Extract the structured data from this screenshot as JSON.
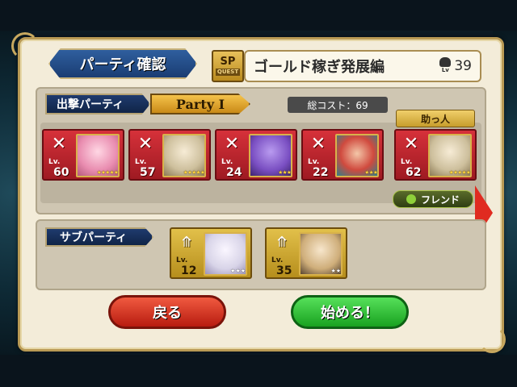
{
  "header": {
    "title": "パーティ確認",
    "sp_badge": "SP",
    "sp_badge_sub": "QUEST",
    "quest_name": "ゴールド稼ぎ発展編",
    "quest_level_label": "Lv",
    "quest_level": "39"
  },
  "party": {
    "label": "出撃パーティ",
    "selected": "Party Ⅰ",
    "total_cost": "総コスト：69",
    "helper_label": "助っ人",
    "friend_label": "フレンド",
    "members": [
      {
        "lv_label": "Lv.",
        "level": "60",
        "stars": "★★★★★",
        "color": "#e98db0"
      },
      {
        "lv_label": "Lv.",
        "level": "57",
        "stars": "★★★★★",
        "color": "#cdbf9c"
      },
      {
        "lv_label": "Lv.",
        "level": "24",
        "stars": "★★★",
        "color": "#7a4fc2"
      },
      {
        "lv_label": "Lv.",
        "level": "22",
        "stars": "★★★",
        "color": "#d04a3e"
      },
      {
        "lv_label": "Lv.",
        "level": "62",
        "stars": "★★★★★",
        "color": "#cdbf9c"
      }
    ]
  },
  "sub_party": {
    "label": "サブパーティ",
    "members": [
      {
        "lv_label": "Lv.",
        "level": "12",
        "stars": "★★★",
        "color": "#d8d4e8"
      },
      {
        "lv_label": "Lv.",
        "level": "35",
        "stars": "★★",
        "color": "#cfae7a"
      }
    ]
  },
  "buttons": {
    "back": "戻る",
    "start": "始める！"
  }
}
